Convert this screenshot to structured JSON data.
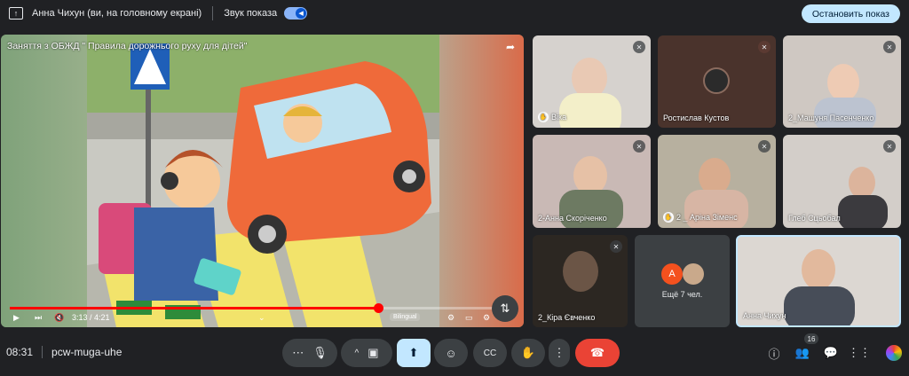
{
  "topbar": {
    "presenter": "Анна Чихун (ви, на головному екрані)",
    "sound_label": "Звук показа",
    "stop_label": "Остановить показ"
  },
  "video": {
    "title": "Заняття з ОБЖД \" Правила дорожнього руху для дітей\"",
    "time_current": "3:13",
    "time_total": "4:21",
    "progress": 0.73,
    "caption_lang": "Bilingual"
  },
  "participants": [
    {
      "name": "Віка",
      "hand_raised": true
    },
    {
      "name": "Ростислав Кустов",
      "hand_raised": false
    },
    {
      "name": "2_Машуня Пасенченко",
      "hand_raised": false
    },
    {
      "name": "2-Анна Скоріченко",
      "hand_raised": false
    },
    {
      "name": "2 _ Аріна Зіменс",
      "hand_raised": true
    },
    {
      "name": "Глеб Сцьобал",
      "hand_raised": false
    },
    {
      "name": "2_Кіра Євченко",
      "hand_raised": false
    },
    {
      "name": "Анна Чихун",
      "hand_raised": false
    }
  ],
  "more": {
    "label": "Ещё 7 чел.",
    "avatar_letter": "A"
  },
  "bottombar": {
    "time": "08:31",
    "meeting_code": "pcw-muga-uhe",
    "participants_count": "16"
  },
  "colors": {
    "accent": "#c2e7ff",
    "end_call": "#ea4335",
    "background": "#202124"
  }
}
